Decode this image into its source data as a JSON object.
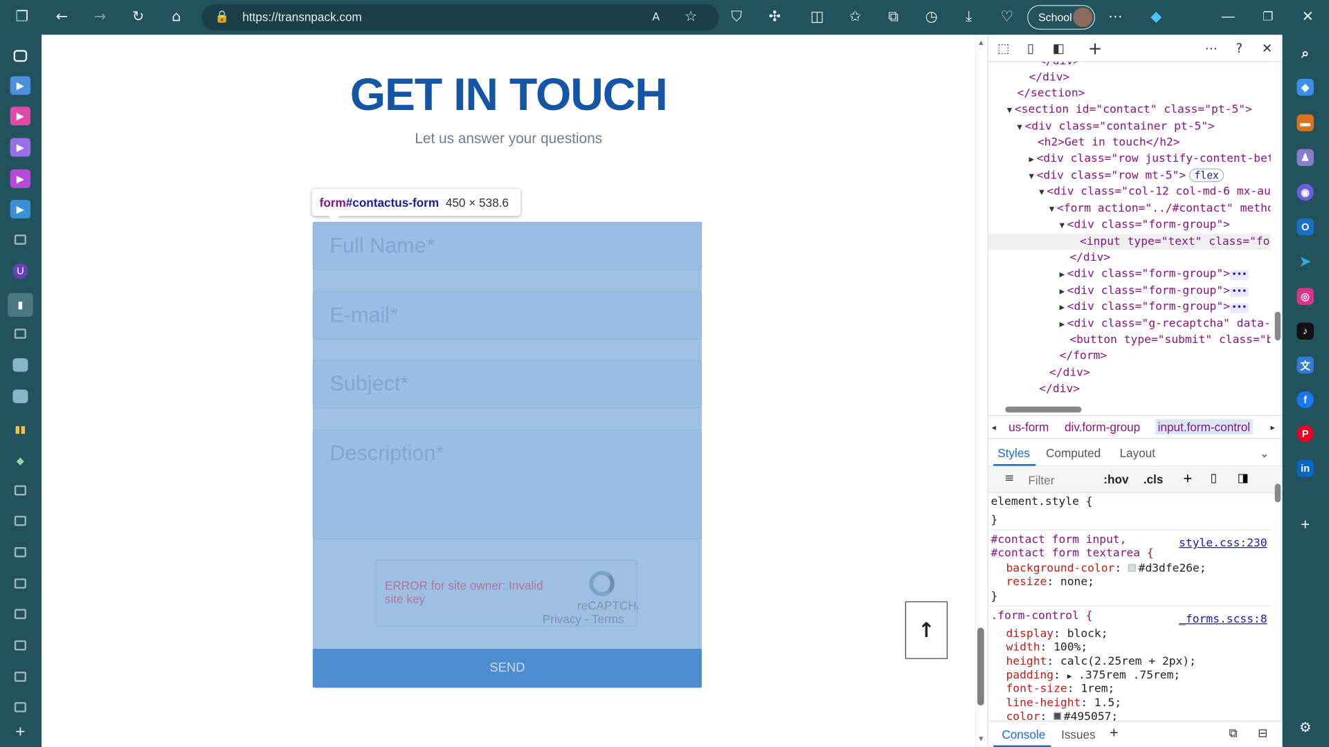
{
  "browser": {
    "url": "https://transnpack.com",
    "profile_label": "School"
  },
  "page": {
    "title": "GET IN TOUCH",
    "subtitle": "Let us answer your questions",
    "tooltip": {
      "tag": "form",
      "id": "#contactus-form",
      "size": "450 × 538.6"
    },
    "form": {
      "full_name_placeholder": "Full Name*",
      "email_placeholder": "E-mail*",
      "subject_placeholder": "Subject*",
      "description_placeholder": "Description*",
      "recaptcha_error": "ERROR for site owner: Invalid site key",
      "recaptcha_name": "reCAPTCHA",
      "recaptcha_links": "Privacy - Terms",
      "send_label": "SEND"
    },
    "back_to_top_icon": "arrow-up-icon"
  },
  "devtools": {
    "dom_lines": [
      {
        "t": "</div>"
      },
      {
        "t": "</div>"
      },
      {
        "t": "</section>"
      },
      {
        "t": "<section id=\"contact\" class=\"pt-5\">"
      },
      {
        "t": "<div class=\"container pt-5\">"
      },
      {
        "t": "<h2>Get in touch</h2>"
      },
      {
        "t": "<div class=\"row justify-content-bet"
      },
      {
        "t": "<div class=\"row mt-5\">"
      },
      {
        "t": "flex"
      },
      {
        "t": "<div class=\"col-12 col-md-6 mx-au"
      },
      {
        "t": "<form action=\"../#contact\" metho"
      },
      {
        "t": "<div class=\"form-group\">"
      },
      {
        "t": "<input type=\"text\" class=\"for"
      },
      {
        "t": "</div>"
      },
      {
        "t": "<div class=\"form-group\">"
      },
      {
        "t": "<div class=\"form-group\">"
      },
      {
        "t": "<div class=\"form-group\">"
      },
      {
        "t": "<div class=\"g-recaptcha\" data-"
      },
      {
        "t": "<button type=\"submit\" class=\"b"
      },
      {
        "t": "</form>"
      },
      {
        "t": "</div>"
      },
      {
        "t": "</div>"
      }
    ],
    "breadcrumbs": [
      "us-form",
      "div.form-group",
      "input.form-control"
    ],
    "tabs": [
      "Styles",
      "Computed",
      "Layout"
    ],
    "filter_placeholder": "Filter",
    "hov": ":hov",
    "cls": ".cls",
    "rules": {
      "element_style": "element.style {",
      "close": "}",
      "r1_sel1": "#contact form input,",
      "r1_sel2": "#contact form textarea {",
      "r1_src": "style.css:230",
      "r1_p1": "background-color",
      "r1_v1": "#d3dfe26e;",
      "r1_p2": "resize",
      "r1_v2": "none;",
      "r2_sel": ".form-control {",
      "r2_src": "_forms.scss:8",
      "r2_p1": "display",
      "r2_v1": "block;",
      "r2_p2": "width",
      "r2_v2": "100%;",
      "r2_p3": "height",
      "r2_v3": "calc(2.25rem + 2px);",
      "r2_p4": "padding",
      "r2_v4": ".375rem .75rem;",
      "r2_p5": "font-size",
      "r2_v5": "1rem;",
      "r2_p6": "line-height",
      "r2_v6": "1.5;",
      "r2_p7": "color",
      "r2_v7": "#495057;"
    },
    "bottom_tabs": [
      "Console",
      "Issues"
    ]
  },
  "colors": {
    "chrome": "#22535c",
    "title_blue": "#1555a5",
    "form_overlay": "#9fc1e4",
    "send_button": "#4e8dcf"
  }
}
